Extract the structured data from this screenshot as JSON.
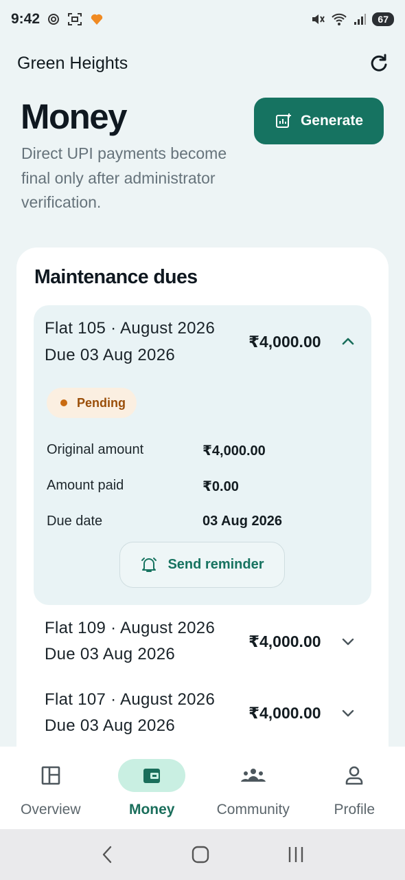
{
  "status_bar": {
    "time": "9:42",
    "battery": "67",
    "left_icons": [
      "chatgpt-icon",
      "screen-capture-icon",
      "app-heart-icon"
    ],
    "right_icons": [
      "mute-icon",
      "wifi-icon",
      "signal-icon"
    ]
  },
  "header": {
    "society_name": "Green Heights",
    "refresh_icon": "refresh-icon"
  },
  "page": {
    "title": "Money",
    "generate_label": "Generate",
    "subtitle": "Direct UPI payments become final only after administrator verification."
  },
  "dues": {
    "section_title": "Maintenance dues",
    "expanded": {
      "title": "Flat 105 · August 2026",
      "due": "Due 03 Aug 2026",
      "amount": "₹4,000.00",
      "status": "Pending",
      "details": [
        {
          "label": "Original amount",
          "value": "₹4,000.00"
        },
        {
          "label": "Amount paid",
          "value": "₹0.00"
        },
        {
          "label": "Due date",
          "value": "03 Aug 2026"
        }
      ],
      "reminder_label": "Send reminder"
    },
    "collapsed": [
      {
        "title": "Flat 109 · August 2026",
        "due": "Due 03 Aug 2026",
        "amount": "₹4,000.00"
      },
      {
        "title": "Flat 107 · August 2026",
        "due": "Due 03 Aug 2026",
        "amount": "₹4,000.00"
      }
    ]
  },
  "bottom_nav": [
    {
      "label": "Overview",
      "icon": "overview-icon",
      "active": false
    },
    {
      "label": "Money",
      "icon": "wallet-icon",
      "active": true
    },
    {
      "label": "Community",
      "icon": "community-icon",
      "active": false
    },
    {
      "label": "Profile",
      "icon": "profile-icon",
      "active": false
    }
  ],
  "colors": {
    "primary": "#167361",
    "background": "#edf4f5",
    "pending_bg": "#fbefe1",
    "pending_text": "#9a4e09",
    "active_nav_bg": "#c9efe2"
  }
}
